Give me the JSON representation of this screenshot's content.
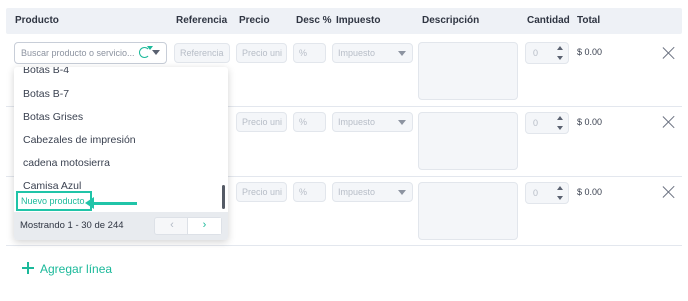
{
  "table": {
    "headers": {
      "product": "Producto",
      "reference": "Referencia",
      "price": "Precio",
      "discount": "Desc %",
      "tax": "Impuesto",
      "description": "Descripción",
      "quantity": "Cantidad",
      "total": "Total"
    },
    "rows": [
      {
        "reference": "Referencia",
        "price": "Precio uni",
        "discount": "%",
        "tax": "Impuesto",
        "quantity": "0",
        "total": "$ 0.00"
      },
      {
        "price": "Precio uni",
        "discount": "%",
        "tax": "Impuesto",
        "quantity": "0",
        "total": "$ 0.00"
      },
      {
        "price": "Precio uni",
        "discount": "%",
        "tax": "Impuesto",
        "quantity": "0",
        "total": "$ 0.00"
      }
    ]
  },
  "product_search": {
    "placeholder": "Buscar producto o servicio...",
    "refresh_icon": "refresh-icon",
    "dropdown_icon": "chevron-down-icon"
  },
  "dropdown": {
    "items": [
      "Botas B-4",
      "Botas B-7",
      "Botas Grises",
      "Cabezales de impresión",
      "cadena motosierra",
      "Camisa Azul"
    ],
    "new_product": "Nuevo producto",
    "paging_text": "Mostrando 1 - 30 de 244",
    "prev": "‹",
    "next": "›"
  },
  "add_line": "Agregar línea",
  "colors": {
    "accent": "#1bb99a",
    "highlight": "#20c4a8",
    "header_bg": "#eef1f6"
  }
}
